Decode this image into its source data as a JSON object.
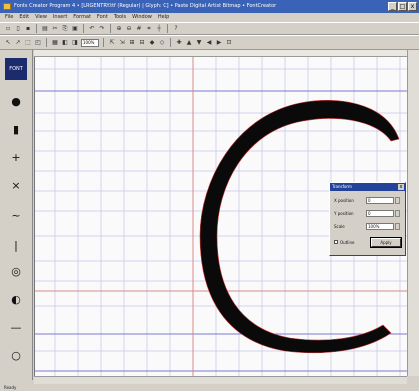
{
  "window": {
    "title": "Fonts Creator Program 4 • [LRGENTRY.ttf (Regular) | Glyph: C] • Paste Digital Artist Bitmap • FontCreator",
    "min_label": "_",
    "max_label": "□",
    "close_label": "x"
  },
  "menu": [
    "File",
    "Edit",
    "View",
    "Insert",
    "Format",
    "Font",
    "Tools",
    "Window",
    "Help"
  ],
  "toolbar1": {
    "buttons": [
      "new-file",
      "open-file",
      "save-file",
      "print",
      "cut",
      "copy",
      "paste",
      "undo",
      "redo",
      "zoom-in",
      "zoom-out",
      "grid",
      "snap",
      "guides",
      "help"
    ],
    "glyphs": [
      "▫",
      "▯",
      "▪",
      "▤",
      "✂",
      "⎘",
      "▣",
      "↶",
      "↷",
      "⊕",
      "⊖",
      "#",
      "⌗",
      "┼",
      "?"
    ]
  },
  "toolbar2": {
    "zoom_value": "100%",
    "glyphs": [
      "↖",
      "↗",
      "⬚",
      "◰",
      "▦",
      "◧",
      "◨",
      "⇱",
      "⇲",
      "⊞",
      "⊟",
      "◆",
      "◇",
      "✚",
      "▲",
      "▼",
      "◀",
      "▶",
      "⊡"
    ]
  },
  "toolbox": {
    "logo_text": "FONT",
    "tools": [
      {
        "name": "circle-tool-icon",
        "glyph": "●"
      },
      {
        "name": "rectangle-tool-icon",
        "glyph": "▮"
      },
      {
        "name": "add-point-icon",
        "glyph": "+"
      },
      {
        "name": "move-point-icon",
        "glyph": "×"
      },
      {
        "name": "line-tool-icon",
        "glyph": "~"
      },
      {
        "name": "vertical-line-icon",
        "glyph": "|"
      },
      {
        "name": "contour-icon",
        "glyph": "◎"
      },
      {
        "name": "ring-icon",
        "glyph": "◐"
      },
      {
        "name": "hline-icon",
        "glyph": "—"
      },
      {
        "name": "outline-circle-icon",
        "glyph": "○"
      }
    ]
  },
  "dialog": {
    "title": "Transform",
    "close_label": "x",
    "fields": [
      {
        "label": "X position",
        "value": "0"
      },
      {
        "label": "Y position",
        "value": "0"
      },
      {
        "label": "Scale",
        "value": "100%"
      }
    ],
    "checkbox_label": "Outline",
    "apply_label": "Apply"
  },
  "statusbar": {
    "text": "Ready"
  },
  "colors": {
    "glyph_fill": "#0a0a0a",
    "grid_line": "#b9b9e6",
    "metric_line": "#7c78d0",
    "guide_line": "#d98a8a",
    "title_bar": "#3a63b8"
  }
}
